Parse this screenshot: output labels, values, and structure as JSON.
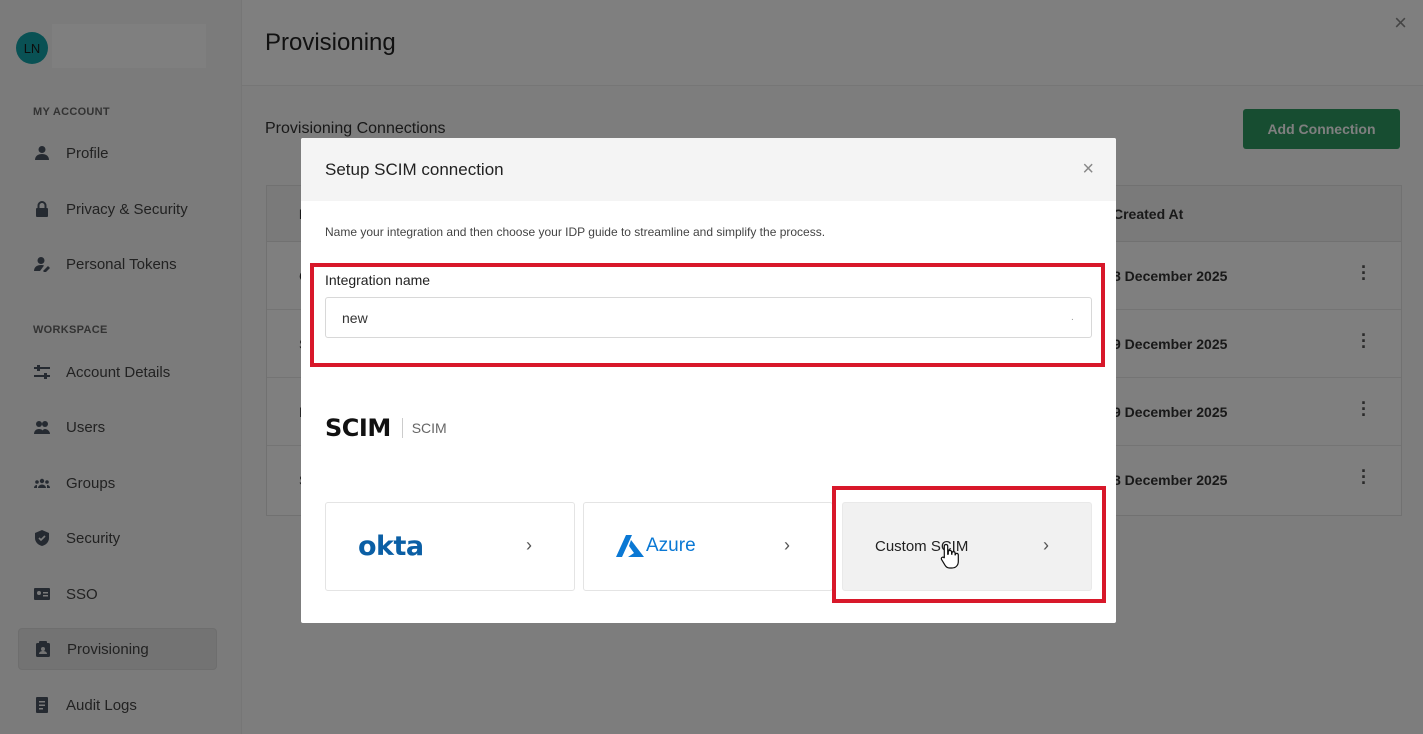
{
  "sidebar": {
    "avatar_initials": "LN",
    "my_account_label": "MY ACCOUNT",
    "workspace_label": "WORKSPACE",
    "items": [
      {
        "label": "Profile",
        "icon": "user-icon"
      },
      {
        "label": "Privacy & Security",
        "icon": "lock-icon"
      },
      {
        "label": "Personal Tokens",
        "icon": "user-key-icon"
      },
      {
        "label": "Account Details",
        "icon": "sliders-icon"
      },
      {
        "label": "Users",
        "icon": "users-icon"
      },
      {
        "label": "Groups",
        "icon": "group-icon"
      },
      {
        "label": "Security",
        "icon": "shield-icon"
      },
      {
        "label": "SSO",
        "icon": "id-card-icon"
      },
      {
        "label": "Provisioning",
        "icon": "provisioning-icon",
        "active": true
      },
      {
        "label": "Audit Logs",
        "icon": "document-icon"
      }
    ]
  },
  "header": {
    "title": "Provisioning",
    "close_symbol": "×"
  },
  "main": {
    "subtitle": "Provisioning Connections",
    "add_button": "Add Connection",
    "table": {
      "columns": {
        "first": "N",
        "created_at": "Created At"
      },
      "rows": [
        {
          "name": "C",
          "created": "8 December 2025"
        },
        {
          "name": "S",
          "created": "9 December 2025"
        },
        {
          "name": "L",
          "created": "9 December 2025"
        },
        {
          "name": "S",
          "created": "8 December 2025"
        }
      ]
    }
  },
  "modal": {
    "title": "Setup SCIM connection",
    "close_symbol": "×",
    "description": "Name your integration and then choose your IDP guide to streamline and simplify the process.",
    "field_label": "Integration name",
    "field_value": "new",
    "scim_logo_text": "SCIM",
    "scim_caption": "SCIM",
    "providers": [
      {
        "label": "okta",
        "chevron": "›"
      },
      {
        "label": "Azure",
        "chevron": "›"
      },
      {
        "label": "Custom SCIM",
        "chevron": "›"
      }
    ]
  },
  "colors": {
    "accent": "#2f9b63",
    "highlight": "#d8182a",
    "okta": "#0b5fa5",
    "azure": "#0a78d4"
  }
}
